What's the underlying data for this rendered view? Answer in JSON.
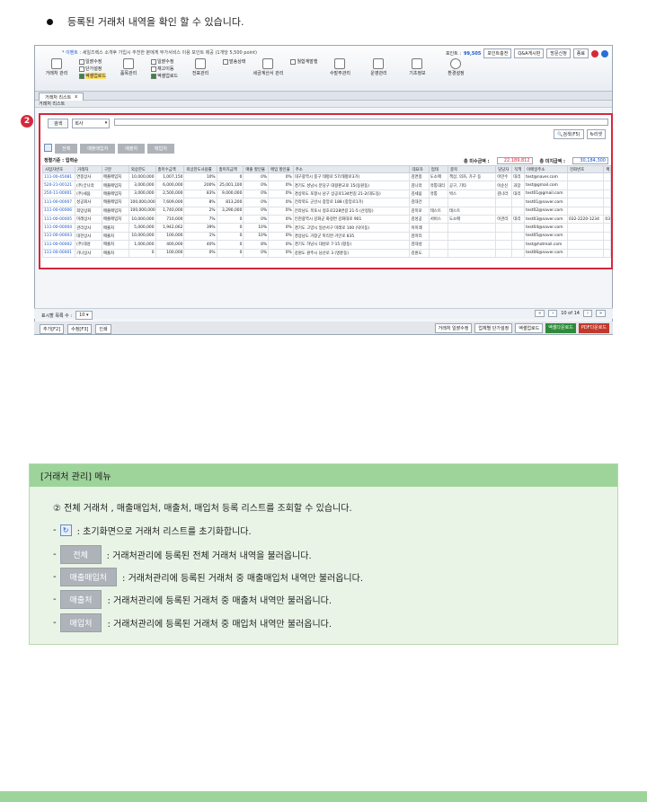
{
  "heading": {
    "bullet_text": "등록된 거래처 내역을 확인 할 수 있습니다."
  },
  "app": {
    "notice_prefix": "* 이벤트 :",
    "notice_text": "세일즈렉스 소개후 가입시 추천한 분에게 부가서비스 이용 포인트 제공 (1개당 5,500 point)",
    "points_label": "포인트 :",
    "points_value": "99,505",
    "top_buttons": [
      "포인트충전",
      "Q&A게시판",
      "방문신청",
      "종료"
    ],
    "menu": {
      "g1_label": "거래처 관리",
      "g1_subs": [
        "일괄수정",
        "단가설정",
        "엑셀업로드"
      ],
      "g2_label": "품목관리",
      "g2_subs": [
        "일괄수정",
        "재고이동",
        "엑셀업로드"
      ],
      "g3_label": "전표관리",
      "g3_subs": [
        "발송상태"
      ],
      "g4_label": "세금계산서 관리",
      "g4_subs": [
        "월합계발행"
      ],
      "g5_label": "수발주관리",
      "g6_label": "운영관리",
      "g7_label": "기초정보",
      "g8_label": "환경설정"
    },
    "tab_label": "거래처 리스트",
    "tab_close": "x",
    "subheader": "거래처 리스트",
    "search": {
      "button": "검색",
      "select_value": "회사",
      "btn_search": "검색(F5)",
      "btn_reset": "리셋"
    },
    "filters": [
      "전체",
      "매출매입처",
      "매출처",
      "매입처"
    ],
    "summary": {
      "left": "정렬기준 : 입력순",
      "receivable_label": "총 미수금액 :",
      "receivable_value": "22,189,812",
      "payable_label": "총 미지급액 :",
      "payable_value": "30,184,300"
    },
    "columns": [
      "사업자번호",
      "거래처",
      "구분",
      "외상한도",
      "총미수금액",
      "외상한도사용률",
      "총미지급액",
      "매출 할인율",
      "매입 할인율",
      "주소",
      "대표자",
      "업태",
      "종목",
      "담당자",
      "직책",
      "이메일주소",
      "전화번호",
      "팩"
    ],
    "rows": [
      [
        "111-00-45081",
        "면몽상사",
        "매출매입처",
        "10,000,000",
        "1,007,150",
        "10%",
        "0",
        "0%",
        "0%",
        "대구광역시 중구 태평로 57(태평로3가)",
        "김면몽",
        "도소매",
        "책상, 의자, 가구 등",
        "이민수",
        "대리",
        "test@naver.com",
        "",
        ""
      ],
      [
        "520-21-00121",
        "(주)굿나라",
        "매출매입처",
        "3,000,000",
        "6,000,000",
        "200%",
        "25,001,100",
        "0%",
        "0%",
        "경기도 성남시 분당구 대왕판교로 15(동원동)",
        "김나라",
        "유통대리",
        "공구, 기타",
        "이순신",
        "과장",
        "test@gmail.com",
        "",
        ""
      ],
      [
        "250-11-00001",
        "(주)세움",
        "매출매입처",
        "3,000,000",
        "2,500,000",
        "83%",
        "9,000,000",
        "0%",
        "0%",
        "경상북도 포항시 남구 상공로134번길 21-2(대도동)",
        "김세움",
        "유통",
        "박스",
        "김나라",
        "대리",
        "test01@gmail.com",
        "",
        ""
      ],
      [
        "111-00-00007",
        "성공회사",
        "매출매입처",
        "100,000,000",
        "7,609,000",
        "8%",
        "813,200",
        "0%",
        "0%",
        "전라북도 군산시 중앙로 188 (중앙로1가)",
        "김대건",
        "",
        "",
        "",
        "",
        "test01@naver.com",
        "",
        ""
      ],
      [
        "111-00-00006",
        "희망상회",
        "매출매입처",
        "100,000,000",
        "1,740,000",
        "2%",
        "3,290,000",
        "0%",
        "0%",
        "전라남도 목포시 정호로228번길 21-5 (산정동)",
        "김목포",
        "테스트",
        "테스트",
        "",
        "",
        "test02@naver.com",
        "",
        ""
      ],
      [
        "111-00-00005",
        "미래상사",
        "매출매입처",
        "10,000,000",
        "710,000",
        "7%",
        "0",
        "0%",
        "0%",
        "인천광역시 강화군 화정면 강화대로 901",
        "김성공",
        "서비스",
        "도소매",
        "이관리",
        "대리",
        "test03@naver.com",
        "032-2220-1234",
        "032"
      ],
      [
        "111-00-00004",
        "관리상사",
        "매출처",
        "5,000,000",
        "1,942,062",
        "39%",
        "0",
        "10%",
        "0%",
        "경기도 고양시 일산서구 미래로 100 (덕이동)",
        "이미래",
        "",
        "",
        "",
        "",
        "test04@naver.com",
        "",
        ""
      ],
      [
        "111-00-00003",
        "대한상사",
        "매출처",
        "10,000,000",
        "100,000",
        "1%",
        "0",
        "10%",
        "0%",
        "경상남도 거창군 마리면 거안로 835",
        "김마리",
        "",
        "",
        "",
        "",
        "test05@naver.com",
        "",
        ""
      ],
      [
        "111-00-00002",
        "(주)대성",
        "매출처",
        "1,000,000",
        "400,000",
        "40%",
        "0",
        "8%",
        "0%",
        "경기도 하남시 대성로 7-15 (항동)",
        "김대성",
        "",
        "",
        "",
        "",
        "test@hotmail.com",
        "",
        ""
      ],
      [
        "111-00-00001",
        "가나상사",
        "매출처",
        "0",
        "100,000",
        "0%",
        "0",
        "0%",
        "0%",
        "강원도 원주시 남산로 3 (명륜동)",
        "김원도",
        "",
        "",
        "",
        "",
        "test06@naver.com",
        "",
        ""
      ]
    ],
    "footer": {
      "rows_label": "표시할 목록 수 :",
      "rows_value": "10",
      "page_text": "10 of 14",
      "left_buttons": [
        "추가[F2]",
        "수정[F3]",
        "인쇄"
      ],
      "right_buttons": [
        "거래처 일괄수정",
        "업체별 단가설정",
        "엑셀업로드",
        "엑셀다운로드",
        "PDF다운로드"
      ]
    }
  },
  "badge": "2",
  "info": {
    "header": "[거래처 관리] 메뉴",
    "desc_num": "②",
    "desc": "전체 거래처 , 매출매입처, 매출처, 매입처 등록 리스트를 조회할 수 있습니다.",
    "items": [
      {
        "text": ": 초기화면으로 거래처 리스트를 초기화합니다."
      },
      {
        "btn": "전체",
        "text": ": 거래처관리에 등록된 전체 거래처 내역을 불러옵니다."
      },
      {
        "btn": "매출매입처",
        "text": ": 거래처관리에 등록된 거래처 중 매출매입처 내역만 불러옵니다."
      },
      {
        "btn": "매출처",
        "text": ": 거래처관리에 등록된 거래처 중 매출처 내역만 불러옵니다."
      },
      {
        "btn": "매입처",
        "text": ": 거래처관리에 등록된 거래처 중 매입처 내역만 불러옵니다."
      }
    ]
  }
}
